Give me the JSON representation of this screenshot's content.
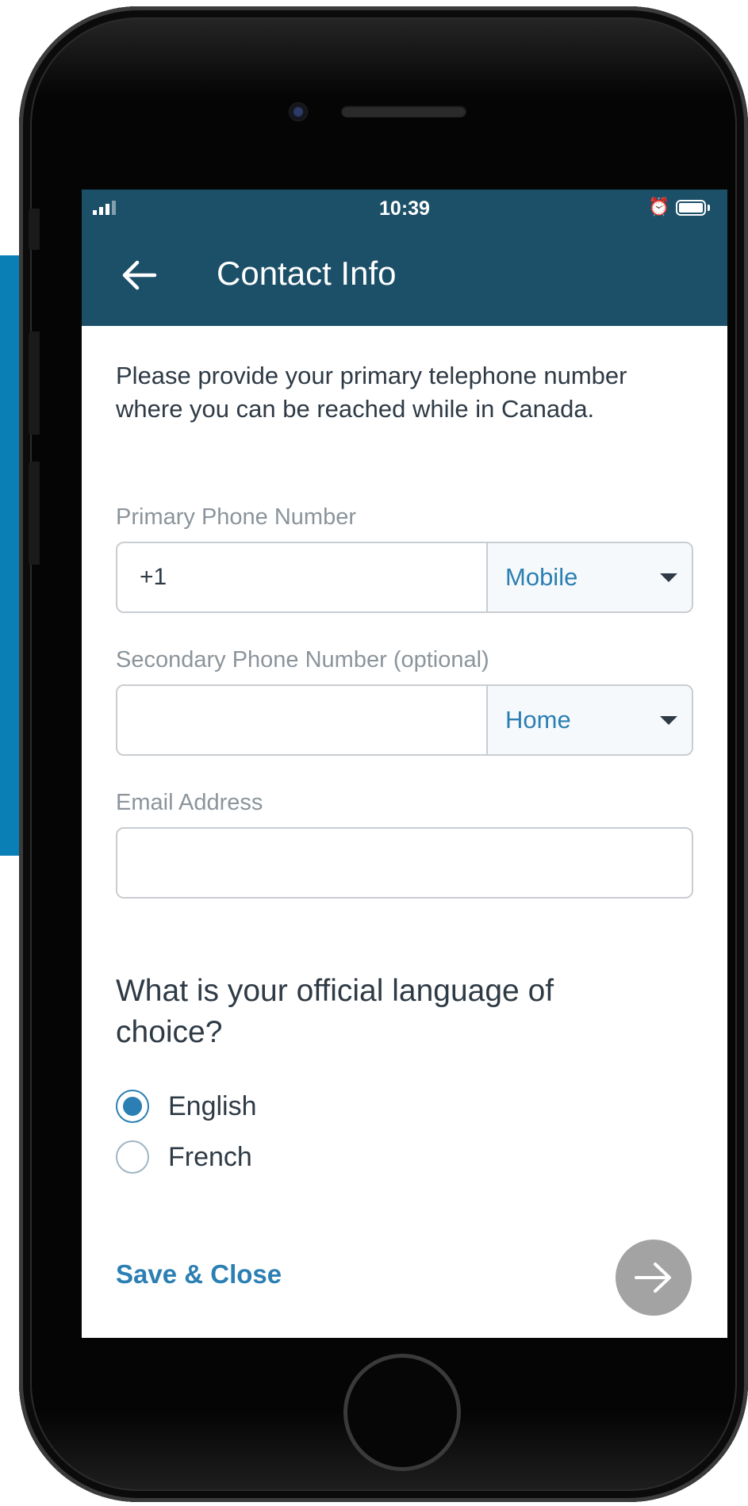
{
  "status_bar": {
    "time": "10:39",
    "alarm_icon": "alarm-clock-icon",
    "battery_icon": "battery-icon",
    "signal_icon": "signal-icon"
  },
  "app_bar": {
    "title": "Contact Info",
    "back_icon": "arrow-left-icon"
  },
  "form": {
    "intro": "Please provide your primary telephone number where you can be reached while in Canada.",
    "primary_phone": {
      "label": "Primary Phone Number",
      "value": "+1",
      "type_value": "Mobile"
    },
    "secondary_phone": {
      "label": "Secondary Phone Number (optional)",
      "value": "",
      "type_value": "Home"
    },
    "email": {
      "label": "Email Address",
      "value": ""
    },
    "language": {
      "question": "What is your official language of choice?",
      "options": [
        {
          "label": "English",
          "selected": true
        },
        {
          "label": "French",
          "selected": false
        }
      ]
    }
  },
  "footer": {
    "save_label": "Save & Close",
    "next_icon": "arrow-right-icon"
  },
  "colors": {
    "header": "#1c5068",
    "accent": "#2b7fb3",
    "next_button": "#a3a3a3"
  }
}
